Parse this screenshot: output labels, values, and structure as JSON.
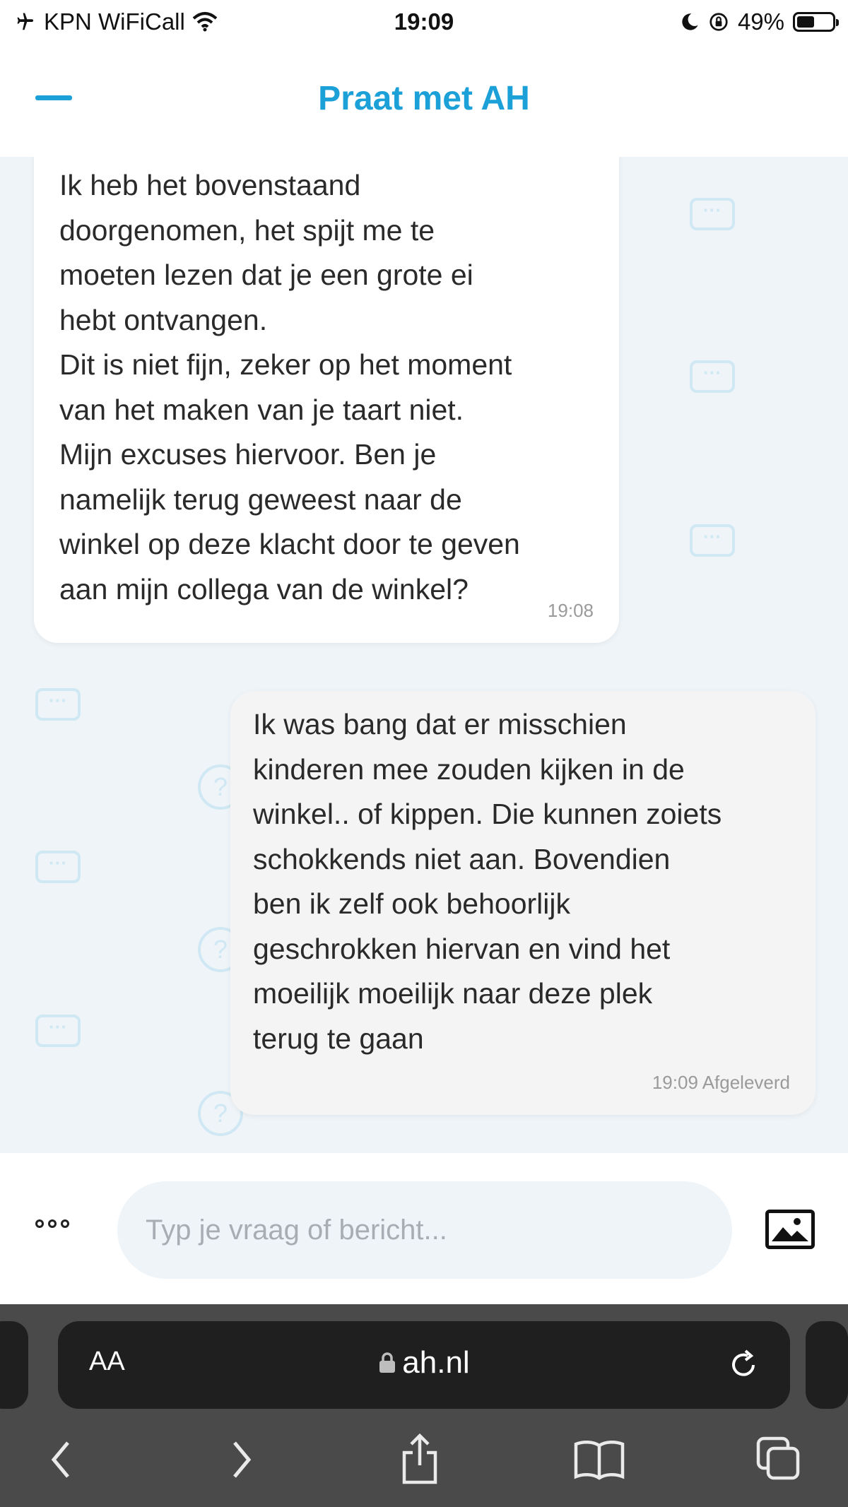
{
  "status_bar": {
    "carrier": "KPN WiFiCall",
    "time": "19:09",
    "battery": "49%",
    "battery_level": 0.49
  },
  "header": {
    "title": "Praat met AH"
  },
  "messages": [
    {
      "direction": "incoming",
      "text": "Ik heb het bovenstaand\ndoorgenomen, het spijt me te\nmoeten lezen dat je een grote ei\nhebt ontvangen.\nDit is niet fijn, zeker op het moment\nvan het maken van je taart niet.\nMijn excuses hiervoor. Ben je\nnamelijk terug geweest naar de\nwinkel op deze klacht door te geven\naan mijn collega van de winkel?",
      "meta": "19:08"
    },
    {
      "direction": "outgoing",
      "text": "Ik was bang dat er misschien\nkinderen mee zouden kijken in de\nwinkel.. of kippen. Die kunnen zoiets\nschokkends niet aan. Bovendien\nben ik zelf ook behoorlijk\ngeschrokken hiervan en vind het\nmoeilijk moeilijk naar deze plek\nterug te gaan",
      "meta": "19:09 Afgeleverd"
    }
  ],
  "composer": {
    "placeholder": "Typ je vraag of bericht..."
  },
  "browser": {
    "text_size_label": "AA",
    "url": "ah.nl"
  },
  "colors": {
    "brand": "#1ba0d8",
    "chat_background": "#eef4f8"
  }
}
